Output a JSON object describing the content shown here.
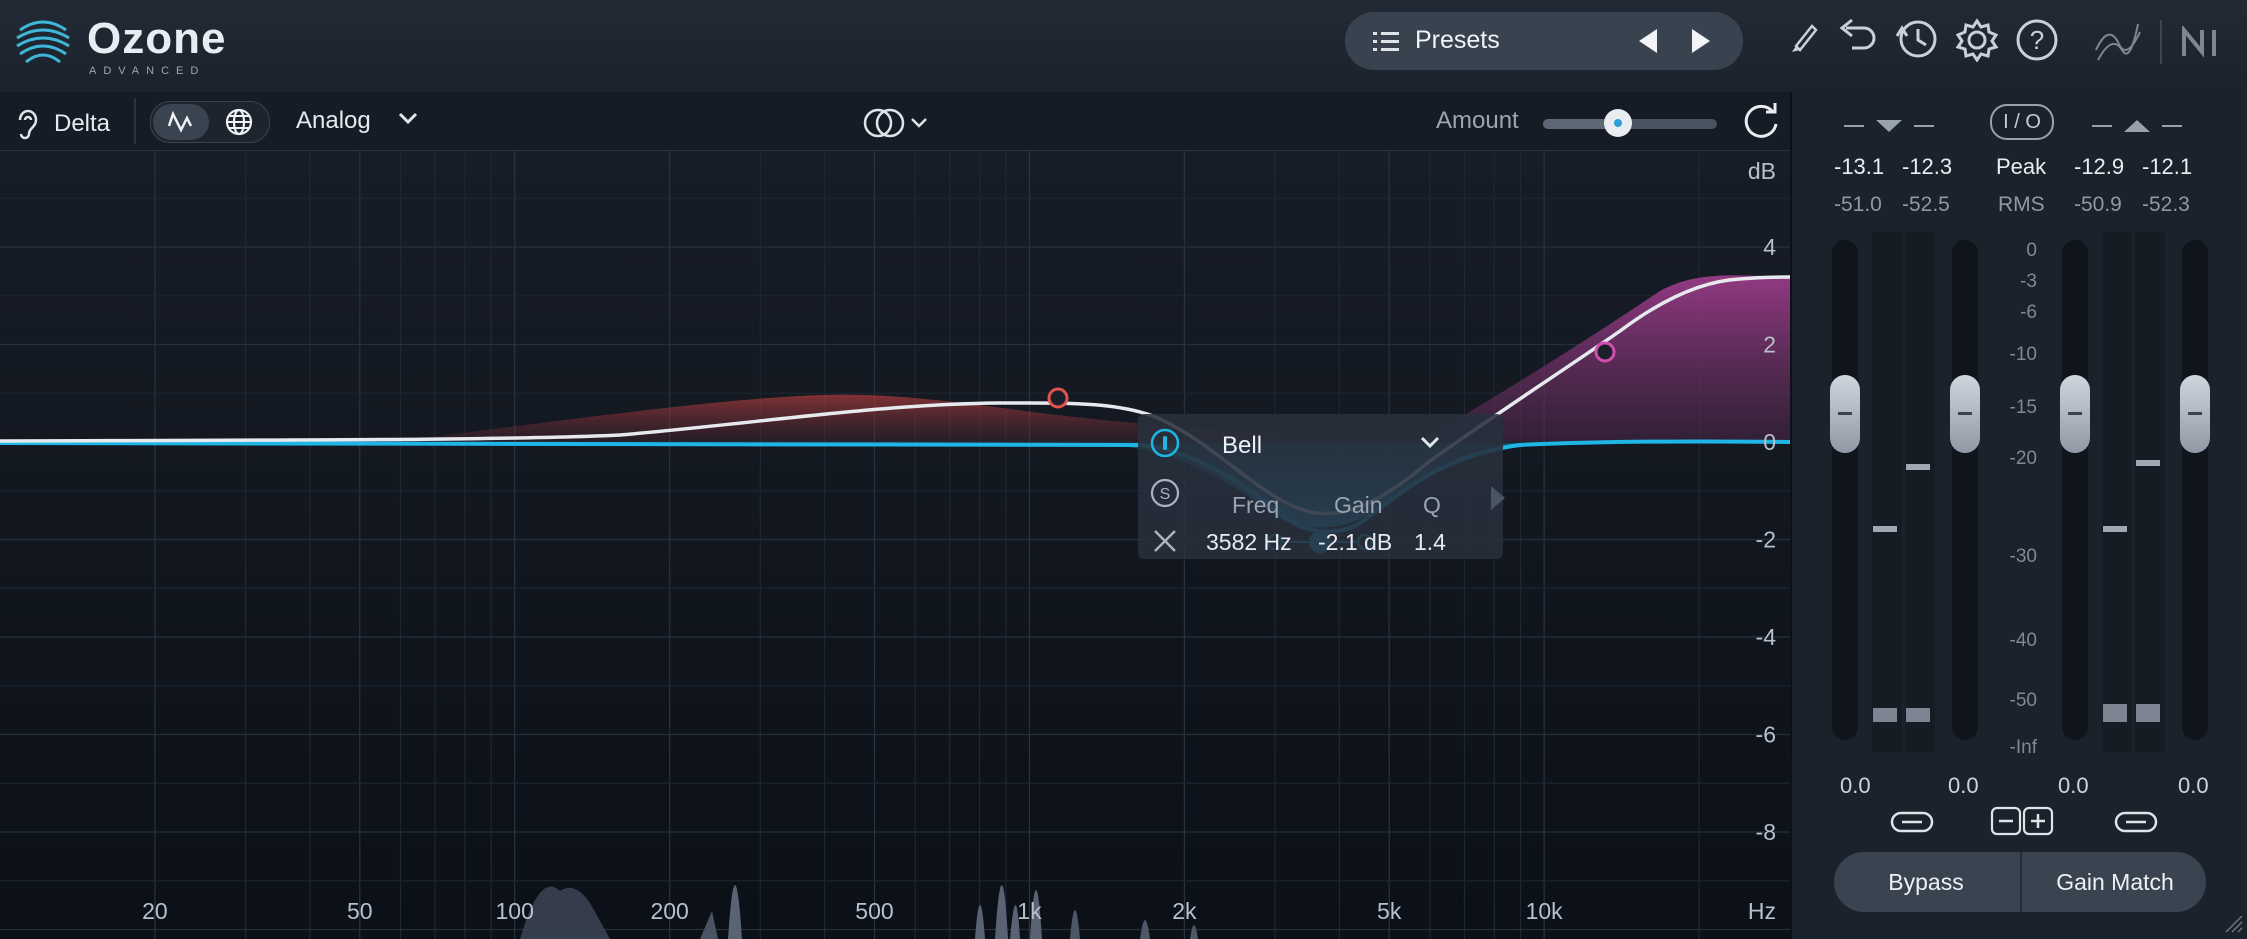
{
  "app": {
    "name": "Ozone",
    "edition": "ADVANCED"
  },
  "topbar": {
    "presets_label": "Presets"
  },
  "toolbar": {
    "delta_label": "Delta",
    "mode_label": "Analog",
    "amount_label": "Amount",
    "amount_value": 0.43
  },
  "eq": {
    "db_unit": "dB",
    "db_ticks": [
      "4",
      "2",
      "0",
      "-2",
      "-4",
      "-6",
      "-8"
    ],
    "freq_ticks": [
      "20",
      "50",
      "100",
      "200",
      "500",
      "1k",
      "2k",
      "5k",
      "10k"
    ],
    "hz_unit": "Hz",
    "colors": {
      "band_red": "#e2524f",
      "band_blue": "#1fb6e6",
      "band_magenta": "#d04fae",
      "curve": "#e6e9ee"
    }
  },
  "band_popup": {
    "shape": "Bell",
    "headers": {
      "freq": "Freq",
      "gain": "Gain",
      "q": "Q"
    },
    "values": {
      "freq": "3582 Hz",
      "gain": "-2.1 dB",
      "q": "1.4"
    }
  },
  "meters": {
    "peak_label": "Peak",
    "rms_label": "RMS",
    "io_label": "I / O",
    "input_peak": [
      "-13.1",
      "-12.3"
    ],
    "input_rms": [
      "-51.0",
      "-52.5"
    ],
    "output_peak": [
      "-12.9",
      "-12.1"
    ],
    "output_rms": [
      "-50.9",
      "-52.3"
    ],
    "scale": [
      "0",
      "-3",
      "-6",
      "-10",
      "-15",
      "-20",
      "-30",
      "-40",
      "-50",
      "-Inf"
    ],
    "gains": [
      "0.0",
      "0.0",
      "0.0",
      "0.0"
    ],
    "bypass_label": "Bypass",
    "gain_match_label": "Gain Match"
  }
}
